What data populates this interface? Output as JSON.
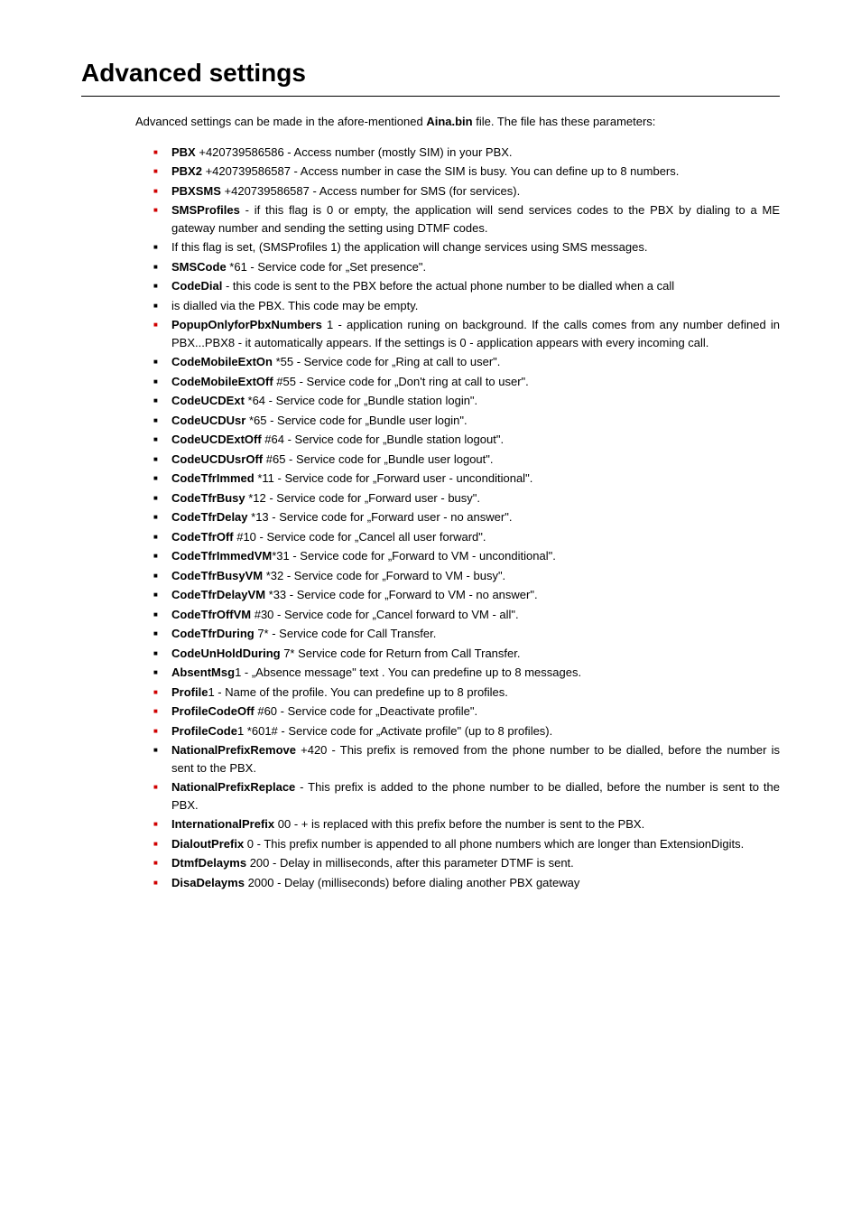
{
  "title": "Advanced settings",
  "intro_pre": "Advanced settings can be made in the afore-mentioned ",
  "intro_bold": "Aina.bin",
  "intro_post": " file. The file has these parameters:",
  "items": [
    {
      "color": "red",
      "bold": "PBX",
      "text": " +420739586586 - Access number (mostly SIM) in your PBX."
    },
    {
      "color": "red",
      "bold": "PBX2",
      "text": " +420739586587 - Access number in case the SIM is busy. You can define up to 8 numbers."
    },
    {
      "color": "red",
      "bold": "PBXSMS",
      "text": " +420739586587 - Access number for SMS (for services)."
    },
    {
      "color": "red",
      "bold": "SMSProfiles",
      "text": " - if this flag is 0 or empty, the application will send services codes to the PBX by dialing to a ME gateway number and sending the setting using DTMF codes."
    },
    {
      "color": "black",
      "bold": "",
      "text": "If this flag is set, (SMSProfiles 1) the application will change services using SMS messages."
    },
    {
      "color": "black",
      "bold": "SMSCode",
      "text": " *61 - Service code for „Set presence\"."
    },
    {
      "color": "black",
      "bold": "CodeDial",
      "text": " - this code is sent to the PBX before the actual phone number to be dialled when a call"
    },
    {
      "color": "black",
      "bold": "",
      "text": "is dialled via the PBX. This code may be empty."
    },
    {
      "color": "red",
      "bold": "PopupOnlyforPbxNumbers",
      "text": " 1 - application runing on background. If the calls comes from any number defined in PBX...PBX8 - it automatically appears. If the settings is 0 - application appears with every incoming call."
    },
    {
      "color": "black",
      "bold": "CodeMobileExtOn",
      "text": " *55 - Service code for „Ring at call to user\"."
    },
    {
      "color": "black",
      "bold": "CodeMobileExtOff",
      "text": " #55 - Service code for „Don't ring at call to user\"."
    },
    {
      "color": "black",
      "bold": "CodeUCDExt",
      "text": " *64 - Service code for „Bundle station login\"."
    },
    {
      "color": "black",
      "bold": "CodeUCDUsr",
      "text": " *65 - Service code for „Bundle user login\"."
    },
    {
      "color": "black",
      "bold": "CodeUCDExtOff",
      "text": " #64 - Service code for „Bundle station logout\"."
    },
    {
      "color": "black",
      "bold": "CodeUCDUsrOff",
      "text": " #65 - Service code for „Bundle user logout\"."
    },
    {
      "color": "black",
      "bold": "CodeTfrImmed",
      "text": " *11 - Service code for „Forward user - unconditional\"."
    },
    {
      "color": "black",
      "bold": "CodeTfrBusy",
      "text": " *12 - Service code for „Forward user - busy\"."
    },
    {
      "color": "black",
      "bold": "CodeTfrDelay",
      "text": " *13 - Service code for „Forward user - no answer\"."
    },
    {
      "color": "black",
      "bold": "CodeTfrOff",
      "text": " #10 - Service code for „Cancel all user forward\"."
    },
    {
      "color": "black",
      "bold": "CodeTfrImmedVM",
      "text": "*31 - Service code for „Forward to VM - unconditional\"."
    },
    {
      "color": "black",
      "bold": "CodeTfrBusyVM",
      "text": " *32 - Service code for „Forward to VM - busy\"."
    },
    {
      "color": "black",
      "bold": "CodeTfrDelayVM",
      "text": " *33 - Service code for „Forward to VM - no answer\"."
    },
    {
      "color": "black",
      "bold": "CodeTfrOffVM",
      "text": " #30 - Service code for „Cancel forward to VM - all\"."
    },
    {
      "color": "black",
      "bold": "CodeTfrDuring",
      "text": " 7* - Service code for Call Transfer."
    },
    {
      "color": "black",
      "bold": "CodeUnHoldDuring",
      "text": " 7* Service code for Return from Call Transfer."
    },
    {
      "color": "black",
      "bold": "AbsentMsg",
      "text": "1 - „Absence message\" text . You can predefine up to 8 messages."
    },
    {
      "color": "red",
      "bold": "Profile",
      "text": "1 - Name of the profile. You can predefine up to 8 profiles."
    },
    {
      "color": "red",
      "bold": "ProfileCodeOff",
      "text": " #60 - Service code for „Deactivate profile\"."
    },
    {
      "color": "red",
      "bold": "ProfileCode",
      "text": "1 *601# - Service code for „Activate profile\" (up to 8 profiles)."
    },
    {
      "color": "black",
      "bold": "NationalPrefixRemove",
      "text": " +420 - This prefix is removed from the phone number to be dialled, before the number is sent to the PBX."
    },
    {
      "color": "red",
      "bold": "NationalPrefixReplace",
      "text": " - This prefix is added to the phone number to be dialled, before the number is sent to the PBX."
    },
    {
      "color": "red",
      "bold": "InternationalPrefix",
      "text": " 00 - + is replaced with this prefix before the number is sent to the PBX."
    },
    {
      "color": "red",
      "bold": "DialoutPrefix",
      "text": " 0 - This prefix number is appended to all phone numbers which are longer than ExtensionDigits."
    },
    {
      "color": "red",
      "bold": "DtmfDelayms",
      "text": " 200 - Delay in milliseconds, after this parameter DTMF is sent."
    },
    {
      "color": "red",
      "bold": "DisaDelayms",
      "text": " 2000 - Delay (milliseconds) before dialing another PBX gateway"
    }
  ]
}
